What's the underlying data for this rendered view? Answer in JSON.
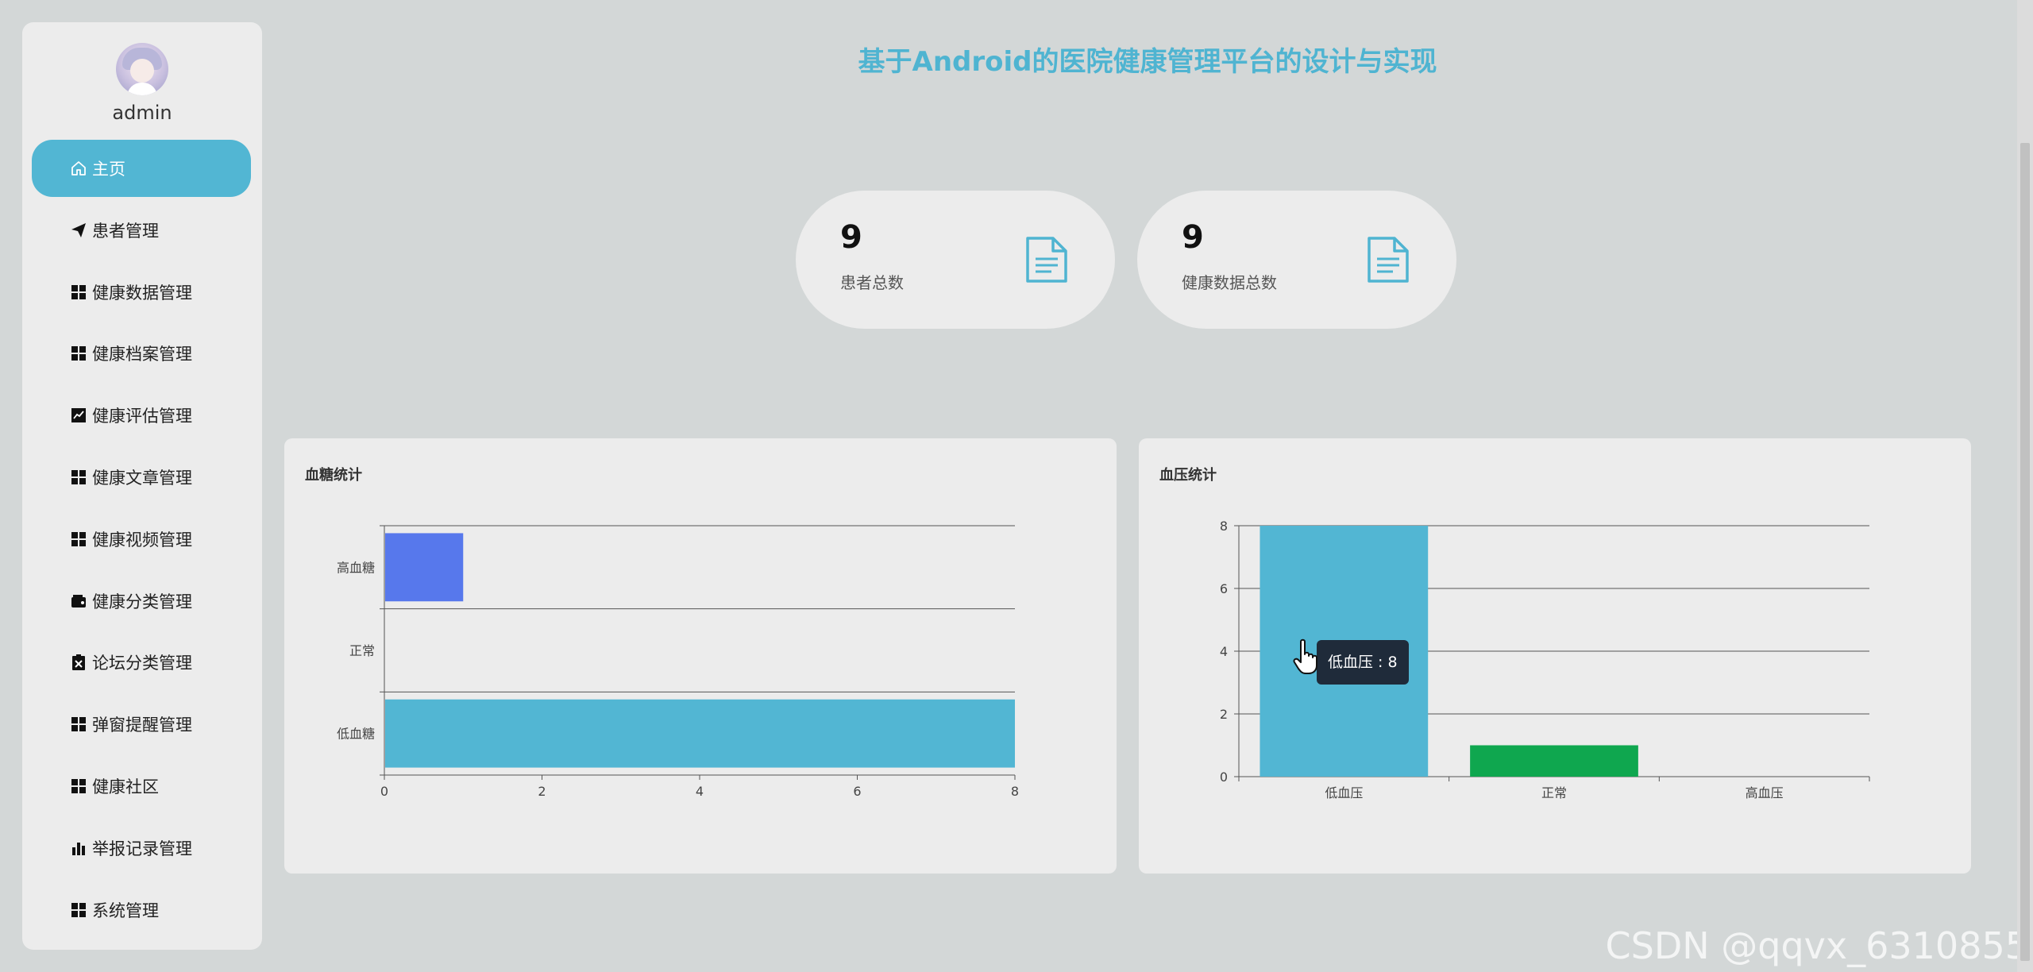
{
  "app_title": "基于Android的医院健康管理平台的设计与实现",
  "user": {
    "name": "admin"
  },
  "sidebar": {
    "items": [
      {
        "label": "主页",
        "icon": "home-icon",
        "active": true
      },
      {
        "label": "患者管理",
        "icon": "send-icon"
      },
      {
        "label": "健康数据管理",
        "icon": "grid-icon"
      },
      {
        "label": "健康档案管理",
        "icon": "grid-icon"
      },
      {
        "label": "健康评估管理",
        "icon": "line-chart-icon"
      },
      {
        "label": "健康文章管理",
        "icon": "grid-icon"
      },
      {
        "label": "健康视频管理",
        "icon": "grid-icon"
      },
      {
        "label": "健康分类管理",
        "icon": "wallet-icon"
      },
      {
        "label": "论坛分类管理",
        "icon": "clipboard-x-icon"
      },
      {
        "label": "弹窗提醒管理",
        "icon": "grid-icon"
      },
      {
        "label": "健康社区",
        "icon": "grid-icon"
      },
      {
        "label": "举报记录管理",
        "icon": "bar-chart-icon"
      },
      {
        "label": "系统管理",
        "icon": "grid-icon"
      }
    ]
  },
  "stats": [
    {
      "value": "9",
      "label": "患者总数",
      "icon": "document-icon"
    },
    {
      "value": "9",
      "label": "健康数据总数",
      "icon": "document-icon"
    }
  ],
  "colors": {
    "accent": "#52b6d3",
    "blue_bar": "#5778ec",
    "green_bar": "#0fa74f",
    "title": "#4fb4d1"
  },
  "chart_data": [
    {
      "type": "bar",
      "orientation": "horizontal",
      "title": "血糖统计",
      "categories": [
        "低血糖",
        "正常",
        "高血糖"
      ],
      "values": [
        8,
        0,
        1
      ],
      "bar_colors": [
        "#52b6d3",
        "#52b6d3",
        "#5778ec"
      ],
      "xlim": [
        0,
        8
      ],
      "xticks": [
        0,
        2,
        4,
        6,
        8
      ],
      "grid": true
    },
    {
      "type": "bar",
      "title": "血压统计",
      "categories": [
        "低血压",
        "正常",
        "高血压"
      ],
      "values": [
        8,
        1,
        0
      ],
      "bar_colors": [
        "#52b6d3",
        "#0fa74f",
        "#52b6d3"
      ],
      "ylim": [
        0,
        8
      ],
      "yticks": [
        0,
        2,
        4,
        6,
        8
      ],
      "grid": true,
      "tooltip": {
        "label": "低血压",
        "value": "8",
        "text": "低血压 : 8"
      }
    }
  ],
  "watermark": "CSDN @qqvx_6310855"
}
